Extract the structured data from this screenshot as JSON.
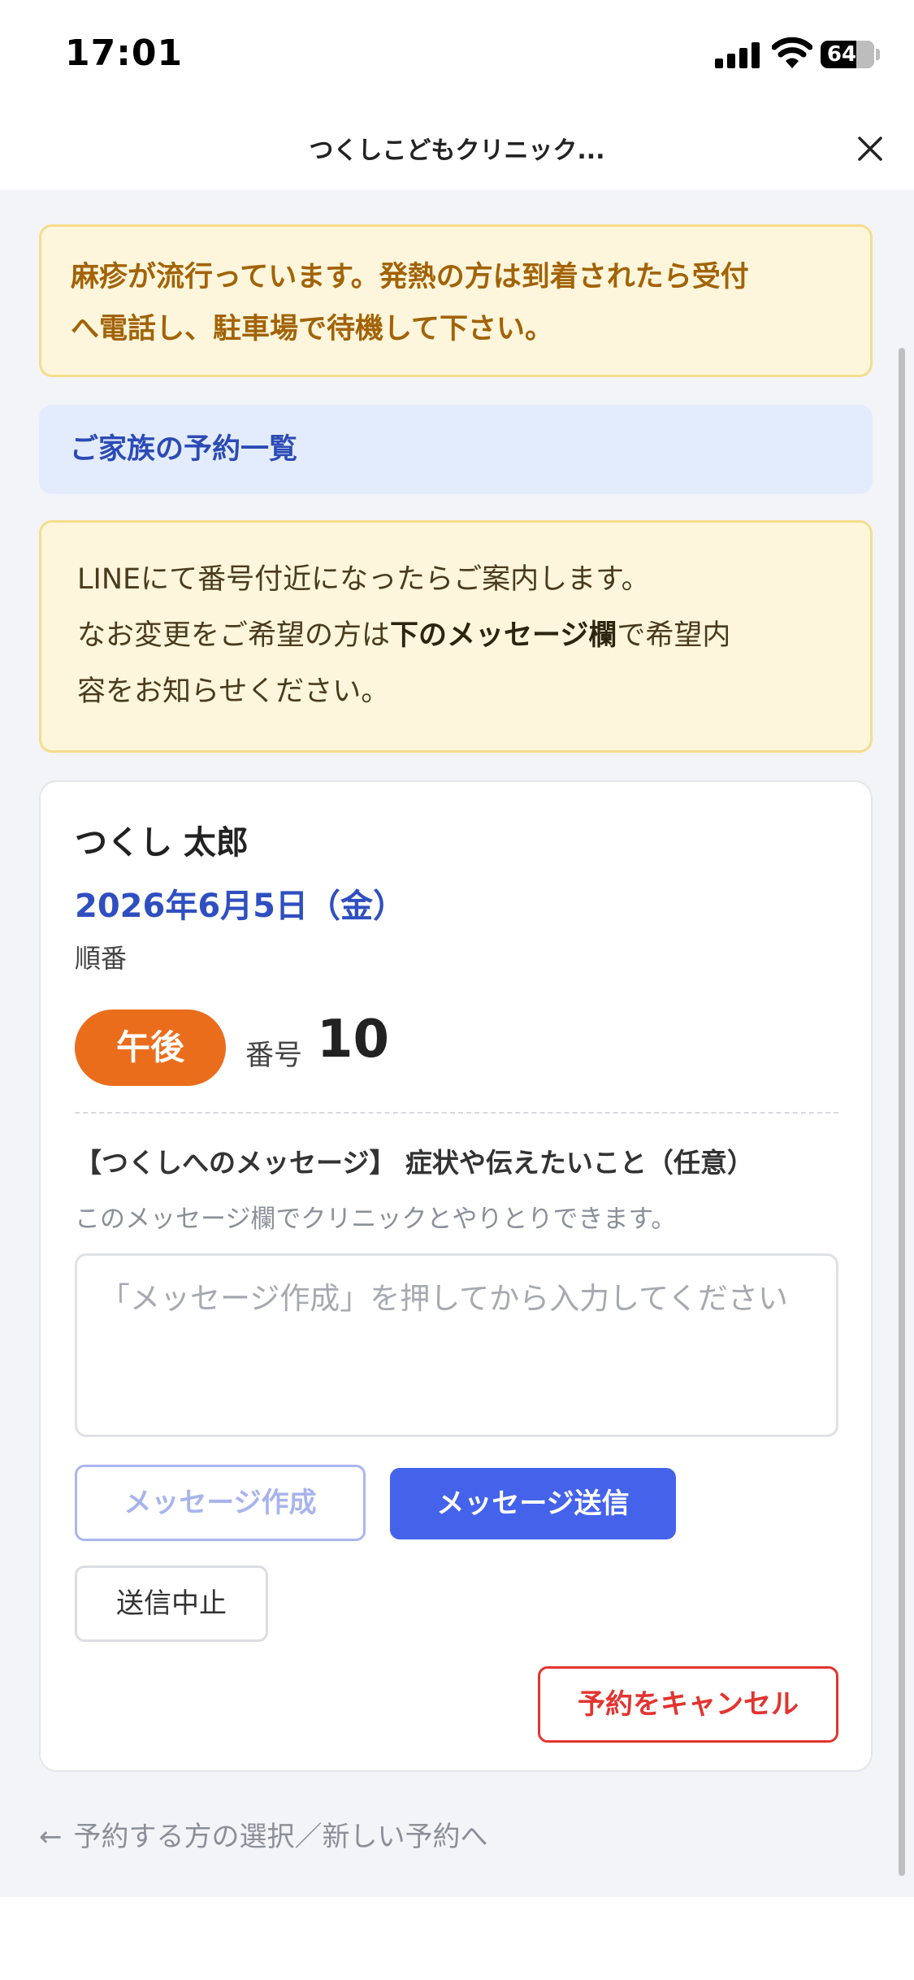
{
  "status_bar": {
    "time": "17:01",
    "battery": "64"
  },
  "header": {
    "title": "つくしこどもクリニック..."
  },
  "notice": {
    "lines": [
      "麻疹が流行っています。発熱の方は到着されたら受付",
      "へ電話し、駐車場で待機して下さい。"
    ]
  },
  "family_list": {
    "label": "ご家族の予約一覧"
  },
  "info": {
    "line1": "LINEにて番号付近になったらご案内します。",
    "line2_pre": "なお変更をご希望の方は",
    "line2_bold": "下のメッセージ欄",
    "line2_post": "で希望内",
    "line3": "容をお知らせください。"
  },
  "reservation": {
    "patient_name": "つくし 太郎",
    "date": "2026年6月5日（金）",
    "order_label": "順番",
    "period": "午後",
    "number_label": "番号",
    "number": "10"
  },
  "message": {
    "title": "【つくしへのメッセージ】 症状や伝えたいこと（任意）",
    "subtitle": "このメッセージ欄でクリニックとやりとりできます。",
    "placeholder": "「メッセージ作成」を押してから入力してください",
    "compose_label": "メッセージ作成",
    "send_label": "メッセージ送信",
    "stop_label": "送信中止"
  },
  "cancel_label": "予約をキャンセル",
  "back_link": {
    "arrow": "←",
    "label": "予約する方の選択／新しい予約へ"
  },
  "colors": {
    "accent": "#4463ea",
    "date": "#2f4fc0",
    "period_badge": "#ea6d1c",
    "danger": "#e3342f",
    "notice_text": "#a26306"
  }
}
